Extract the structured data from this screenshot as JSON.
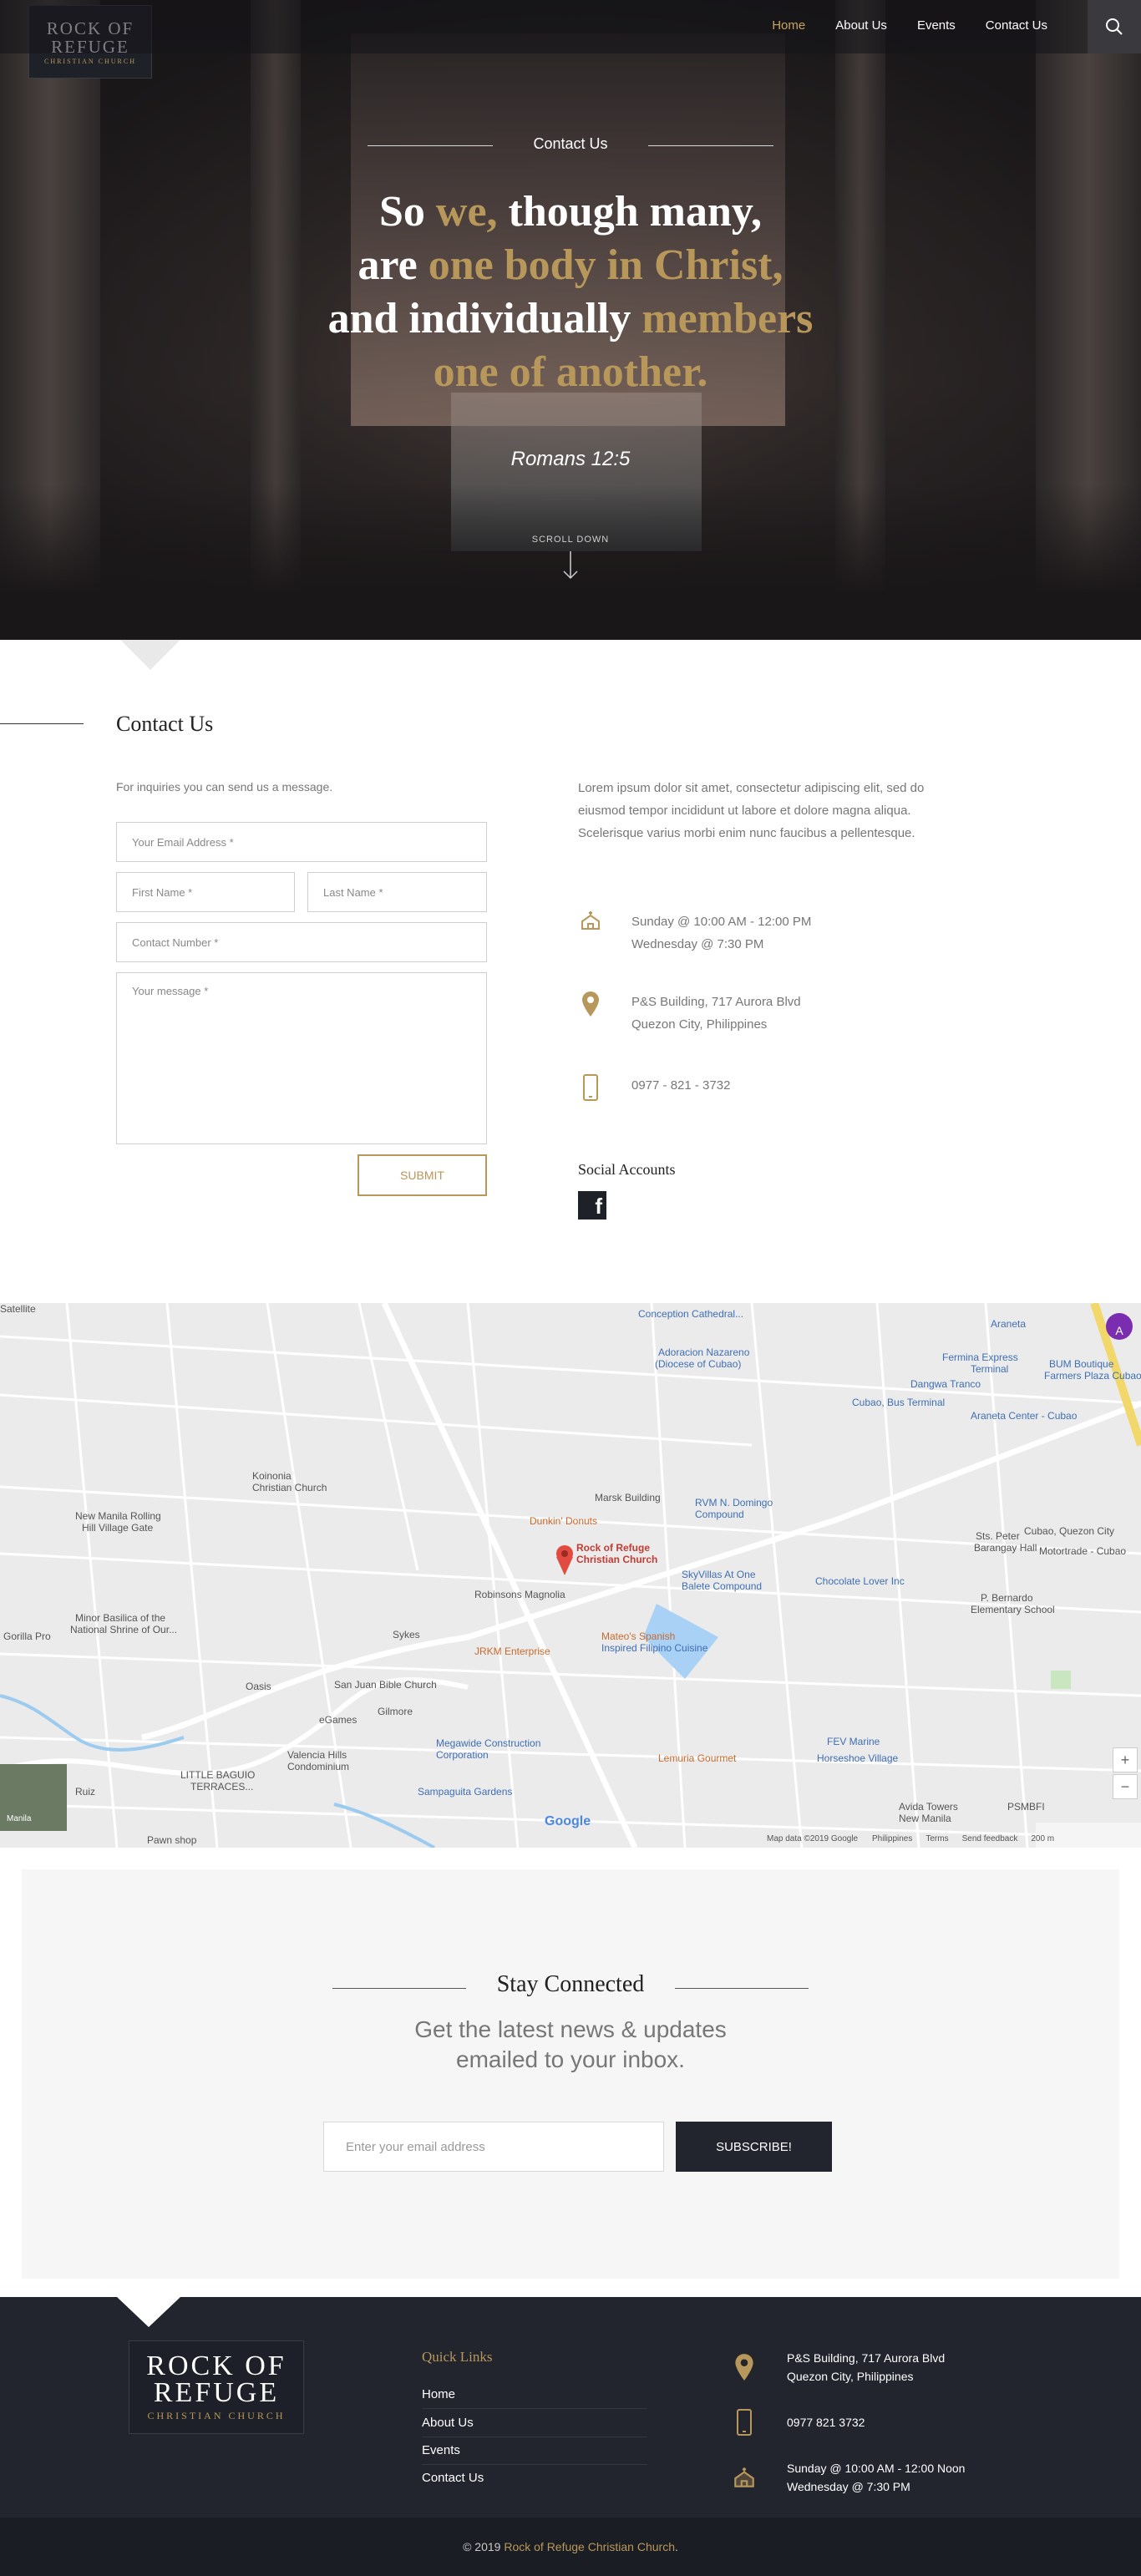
{
  "header": {
    "logo": {
      "line1": "ROCK OF",
      "line2": "REFUGE",
      "line3": "CHRISTIAN CHURCH"
    },
    "nav": [
      {
        "label": "Home",
        "active": true
      },
      {
        "label": "About Us"
      },
      {
        "label": "Events"
      },
      {
        "label": "Contact Us"
      }
    ],
    "search_icon": "search-icon"
  },
  "hero": {
    "kicker": "Contact Us",
    "quote": {
      "line1": [
        {
          "t": "So ",
          "gold": false
        },
        {
          "t": "we,",
          "gold": true
        },
        {
          "t": " though many,",
          "gold": false
        }
      ],
      "line2": [
        {
          "t": "are ",
          "gold": false
        },
        {
          "t": "one body in Christ,",
          "gold": true
        }
      ],
      "line3": [
        {
          "t": "and individually ",
          "gold": false
        },
        {
          "t": "members",
          "gold": true
        }
      ],
      "line4": [
        {
          "t": "one of another.",
          "gold": true
        }
      ]
    },
    "verse": "Romans 12:5",
    "scroll_label": "SCROLL DOWN"
  },
  "contact": {
    "title": "Contact Us",
    "intro": "For inquiries you can send us a message.",
    "fields": {
      "email_placeholder": "Your Email Address *",
      "first_name_placeholder": "First Name *",
      "last_name_placeholder": "Last Name *",
      "contact_placeholder": "Contact Number *",
      "message_placeholder": "Your message *"
    },
    "submit_label": "SUBMIT",
    "lorem": "Lorem ipsum dolor sit amet, consectetur adipiscing elit, sed do eiusmod tempor incididunt ut labore et dolore magna aliqua. Scelerisque varius morbi enim nunc faucibus a pellentesque.",
    "schedule": {
      "line1": "Sunday @ 10:00 AM - 12:00 PM",
      "line2": "Wednesday @ 7:30 PM"
    },
    "address": {
      "line1": "P&S Building, 717 Aurora Blvd",
      "line2": "Quezon City, Philippines"
    },
    "phone": "0977 - 821 - 3732",
    "social_title": "Social Accounts",
    "social_icon": "facebook-icon"
  },
  "map": {
    "pin_label_1": "Rock of Refuge",
    "pin_label_2": "Christian Church",
    "labels": [
      "Conception Cathedral...",
      "Adoracion Nazareno",
      "(Diocese of Cubao)",
      "Fermina Express",
      "Terminal",
      "Dangwa Tranco",
      "Cubao, Bus Terminal",
      "Araneta Center - Cubao",
      "BUM Boutique",
      "Farmers Plaza Cubao",
      "Araneta",
      "Koinonia",
      "Christian Church",
      "New Manila Rolling",
      "Hill Village Gate",
      "Marsk Building",
      "RVM N. Domingo",
      "Compound",
      "Dunkin' Donuts",
      "Robinsons Magnolia",
      "SkyVillas At One",
      "Balete Compound",
      "Chocolate Lover Inc",
      "P. Bernardo",
      "Elementary School",
      "Sts. Peter",
      "Barangay Hall",
      "Cubao, Quezon City",
      "Motortrade - Cubao",
      "Minor Basilica of the",
      "National Shrine of Our...",
      "Sykes",
      "JRKM Enterprise",
      "Mateo's Spanish",
      "Inspired Filipino Cuisine",
      "Gorilla Pro",
      "Oasis",
      "San Juan Bible Church",
      "Gilmore",
      "eGames",
      "Megawide Construction",
      "Corporation",
      "Valencia Hills",
      "Condominium",
      "LITTLE BAGUIO",
      "TERRACES...",
      "Sampaguita Gardens",
      "Lemuria Gourmet",
      "FEV Marine",
      "Horseshoe Village",
      "Avida Towers",
      "New Manila",
      "PSMBFI",
      "Ruiz",
      "Pawn shop",
      "Manila",
      "Satellite"
    ],
    "attribution": "Map data ©2019 Google",
    "terms": [
      "Philippines",
      "Terms",
      "Send feedback",
      "200 m"
    ],
    "google": "Google"
  },
  "newsletter": {
    "title": "Stay Connected",
    "sub1": "Get the latest news & updates",
    "sub2": "emailed to your inbox.",
    "placeholder": "Enter your email address",
    "button": "SUBSCRIBE!"
  },
  "footer": {
    "quick_links_title": "Quick Links",
    "links": [
      "Home",
      "About Us",
      "Events",
      "Contact Us"
    ],
    "address": {
      "line1": "P&S Building, 717 Aurora Blvd",
      "line2": "Quezon City, Philippines"
    },
    "phone": "0977 821 3732",
    "schedule": {
      "line1": "Sunday @ 10:00 AM - 12:00 Noon",
      "line2": "Wednesday @ 7:30 PM"
    },
    "copyright_prefix": "© 2019 ",
    "copyright_brand": "Rock of Refuge Christian Church",
    "copyright_suffix": "."
  },
  "colors": {
    "gold": "#b8975a",
    "dark": "#22252e"
  }
}
